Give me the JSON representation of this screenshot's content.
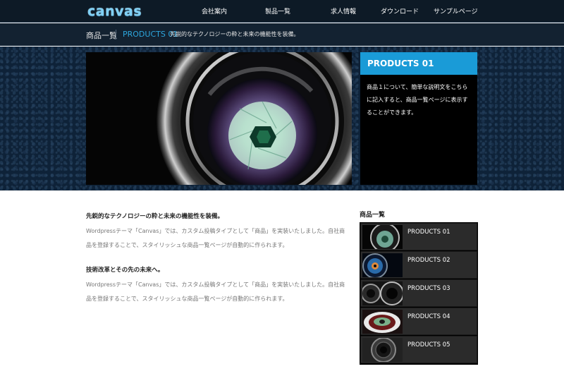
{
  "header": {
    "logo": "canvas",
    "nav": [
      {
        "label": "会社案内"
      },
      {
        "label": "製品一覧"
      },
      {
        "label": "求人情報"
      },
      {
        "label": "ダウンロード"
      },
      {
        "label": "サンプルページ"
      }
    ]
  },
  "breadcrumb": {
    "title": "商品一覧",
    "current": "PRODUCTS 01",
    "tagline": "先鋭的なテクノロジーの粋と未来の機能性を装備。"
  },
  "hero": {
    "image_icon": "camera-lens",
    "panel_title": "PRODUCTS 01",
    "panel_text": "商品１について、簡単な説明文をこちらに記入すると、商品一覧ページに表示することができます。"
  },
  "content": {
    "blocks": [
      {
        "heading": "先鋭的なテクノロジーの粋と未来の機能性を装備。",
        "body": "Wordpressテーマ「Canvas」では、カスタム投稿タイプとして「商品」を実装いたしました。自社商品を登録することで、スタイリッシュな商品一覧ページが自動的に作られます。"
      },
      {
        "heading": "技術改革とその先の未来へ。",
        "body": "Wordpressテーマ「Canvas」では、カスタム投稿タイプとして「商品」を実装いたしました。自社商品を登録することで、スタイリッシュな商品一覧ページが自動的に作られます。"
      }
    ]
  },
  "sidebar": {
    "title": "商品一覧",
    "items": [
      {
        "label": "PRODUCTS 01"
      },
      {
        "label": "PRODUCTS 02"
      },
      {
        "label": "PRODUCTS 03"
      },
      {
        "label": "PRODUCTS 04"
      },
      {
        "label": "PRODUCTS 05"
      }
    ]
  },
  "colors": {
    "accent": "#1a9bd7",
    "header_bg": "#0d1a26",
    "link_blue": "#2da6dd"
  }
}
